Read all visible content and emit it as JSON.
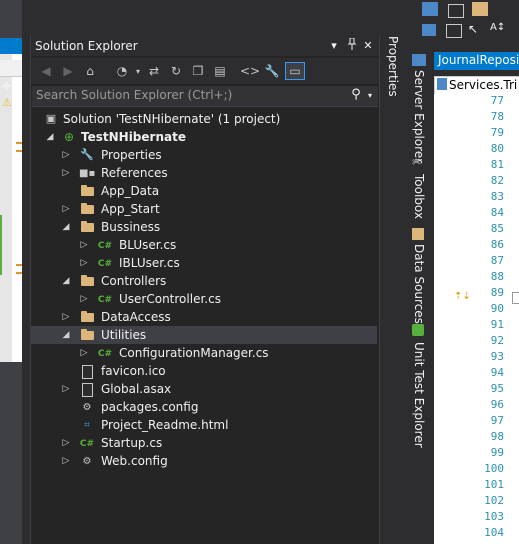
{
  "solution_explorer": {
    "title": "Solution Explorer",
    "title_buttons": {
      "dropdown": "▾",
      "pin": "🖈",
      "close": "✕"
    },
    "toolbar_icons": [
      "back-icon",
      "forward-icon",
      "home-icon",
      "history-icon",
      "sync-icon",
      "refresh-icon",
      "collapse-all-icon",
      "show-all-files-icon",
      "view-code-icon",
      "properties-icon",
      "preview-icon"
    ],
    "search": {
      "placeholder": "Search Solution Explorer (Ctrl+;)"
    },
    "tree": [
      {
        "label": "Solution 'TestNHibernate' (1 project)",
        "icon": "solution-icon",
        "indent": 0,
        "expander": "",
        "bold": false
      },
      {
        "label": "TestNHibernate",
        "icon": "web-project-icon",
        "indent": 1,
        "expander": "open",
        "bold": true
      },
      {
        "label": "Properties",
        "icon": "wrench-icon",
        "indent": 2,
        "expander": "closed"
      },
      {
        "label": "References",
        "icon": "references-icon",
        "indent": 2,
        "expander": "closed"
      },
      {
        "label": "App_Data",
        "icon": "folder-icon",
        "indent": 2,
        "expander": ""
      },
      {
        "label": "App_Start",
        "icon": "folder-icon",
        "indent": 2,
        "expander": "closed"
      },
      {
        "label": "Bussiness",
        "icon": "folder-icon",
        "indent": 2,
        "expander": "open"
      },
      {
        "label": "BLUser.cs",
        "icon": "csharp-file-icon",
        "indent": 3,
        "expander": "closed"
      },
      {
        "label": "IBLUser.cs",
        "icon": "csharp-file-icon",
        "indent": 3,
        "expander": "closed"
      },
      {
        "label": "Controllers",
        "icon": "folder-icon",
        "indent": 2,
        "expander": "open"
      },
      {
        "label": "UserController.cs",
        "icon": "csharp-file-icon",
        "indent": 3,
        "expander": "closed"
      },
      {
        "label": "DataAccess",
        "icon": "folder-icon",
        "indent": 2,
        "expander": "closed"
      },
      {
        "label": "Utilities",
        "icon": "folder-icon",
        "indent": 2,
        "expander": "open",
        "selected": true
      },
      {
        "label": "ConfigurationManager.cs",
        "icon": "csharp-file-icon",
        "indent": 3,
        "expander": "closed"
      },
      {
        "label": "favicon.ico",
        "icon": "file-icon",
        "indent": 2,
        "expander": ""
      },
      {
        "label": "Global.asax",
        "icon": "file-icon",
        "indent": 2,
        "expander": "closed"
      },
      {
        "label": "packages.config",
        "icon": "config-file-icon",
        "indent": 2,
        "expander": ""
      },
      {
        "label": "Project_Readme.html",
        "icon": "html-file-icon",
        "indent": 2,
        "expander": ""
      },
      {
        "label": "Startup.cs",
        "icon": "csharp-file-icon",
        "indent": 2,
        "expander": "closed"
      },
      {
        "label": "Web.config",
        "icon": "config-file-icon",
        "indent": 2,
        "expander": "closed"
      }
    ]
  },
  "properties_tab": {
    "label": "Properties"
  },
  "side_tabs": [
    {
      "label": "Server Explorer",
      "icon": "server-icon"
    },
    {
      "label": "Toolbox",
      "icon": "toolbox-icon"
    },
    {
      "label": "Data Sources",
      "icon": "data-sources-icon"
    },
    {
      "label": "Unit Test Explorer",
      "icon": "unit-test-icon"
    }
  ],
  "editor": {
    "tab_label": "JournalReposito",
    "nav_label": "Services.Tri",
    "line_numbers": [
      "77",
      "78",
      "79",
      "80",
      "81",
      "82",
      "83",
      "84",
      "85",
      "86",
      "87",
      "88",
      "89",
      "90",
      "91",
      "92",
      "93",
      "94",
      "95",
      "96",
      "97",
      "98",
      "99",
      "100",
      "101",
      "102",
      "103",
      "104"
    ]
  },
  "colors": {
    "accent": "#007acc",
    "background": "#2d2d30",
    "panel": "#252526",
    "selected_row": "#3f3f46",
    "folder": "#dcb67a",
    "csharp": "#57b03b",
    "line_number": "#2b91af"
  }
}
